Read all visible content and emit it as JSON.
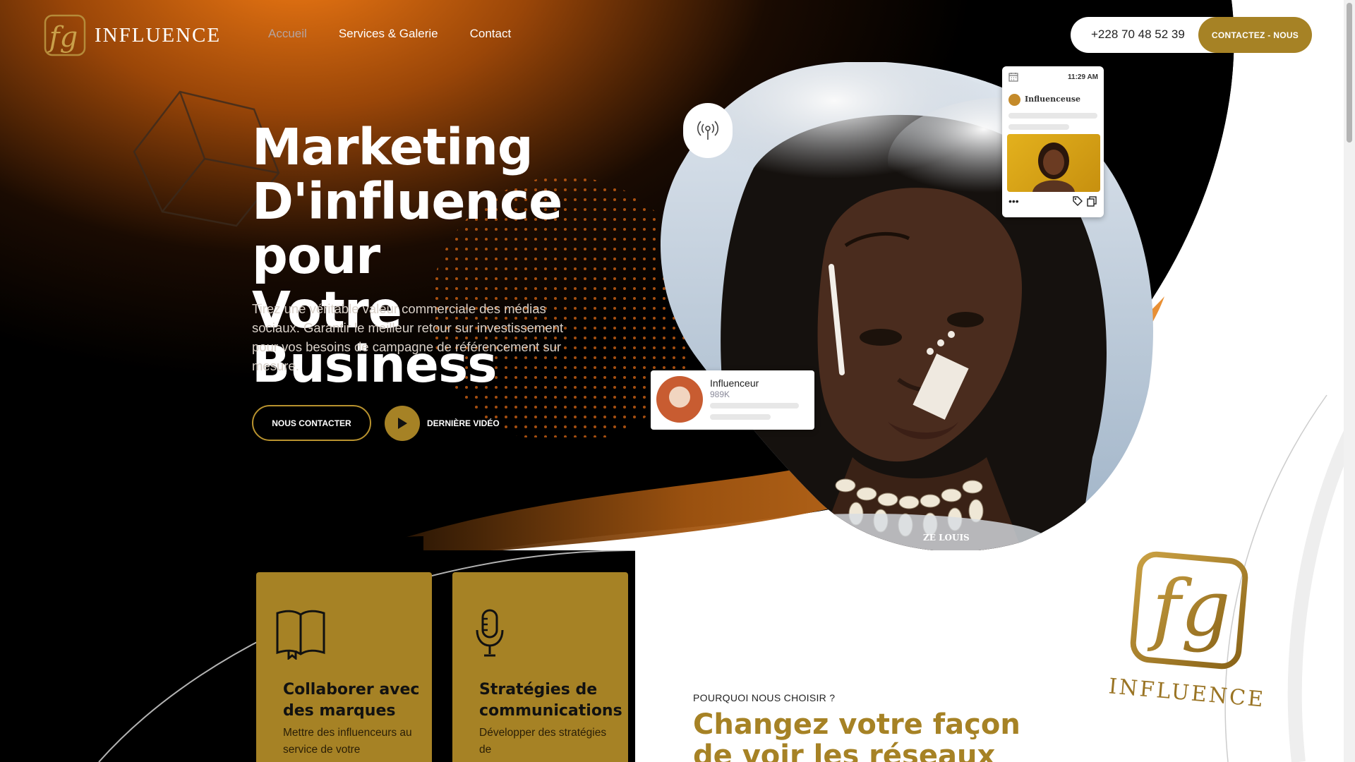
{
  "header": {
    "logo_text": "INFLUENCE",
    "nav": [
      {
        "label": "Accueil",
        "active": true
      },
      {
        "label": "Services & Galerie",
        "active": false
      },
      {
        "label": "Contact",
        "active": false
      }
    ],
    "phone": "+228 70 48 52 39",
    "cta": "CONTACTEZ - NOUS"
  },
  "hero": {
    "title_line1": "Marketing",
    "title_line2": "D'influence pour",
    "title_line3": "Votre Business",
    "description": "Tirez une véritable valeur commerciale des médias sociaux. Garantir le meilleur retour sur investissement pour vos besoins de campagne de référencement sur mesure.",
    "contact_button": "NOUS CONTACTER",
    "video_button": "DERNIÈRE VIDÉO"
  },
  "post_card": {
    "time": "11:29 AM",
    "name": "Influenceuse"
  },
  "influencer_card": {
    "name": "Influenceur",
    "count": "989K"
  },
  "photo_credit": "ZE LOUIS",
  "features": [
    {
      "title": "Collaborer avec des marques",
      "text": "Mettre des influenceurs au service de votre",
      "icon": "book-icon"
    },
    {
      "title": "Stratégies de communications",
      "text": "Développer des stratégies de",
      "icon": "microphone-icon"
    }
  ],
  "why": {
    "kicker": "POURQUOI NOUS CHOISIR ?",
    "title": "Changez votre façon de voir les réseaux"
  },
  "big_logo_text": "INFLUENCE",
  "colors": {
    "gold": "#a68225",
    "orange": "#e0791e",
    "dark": "#000000"
  }
}
